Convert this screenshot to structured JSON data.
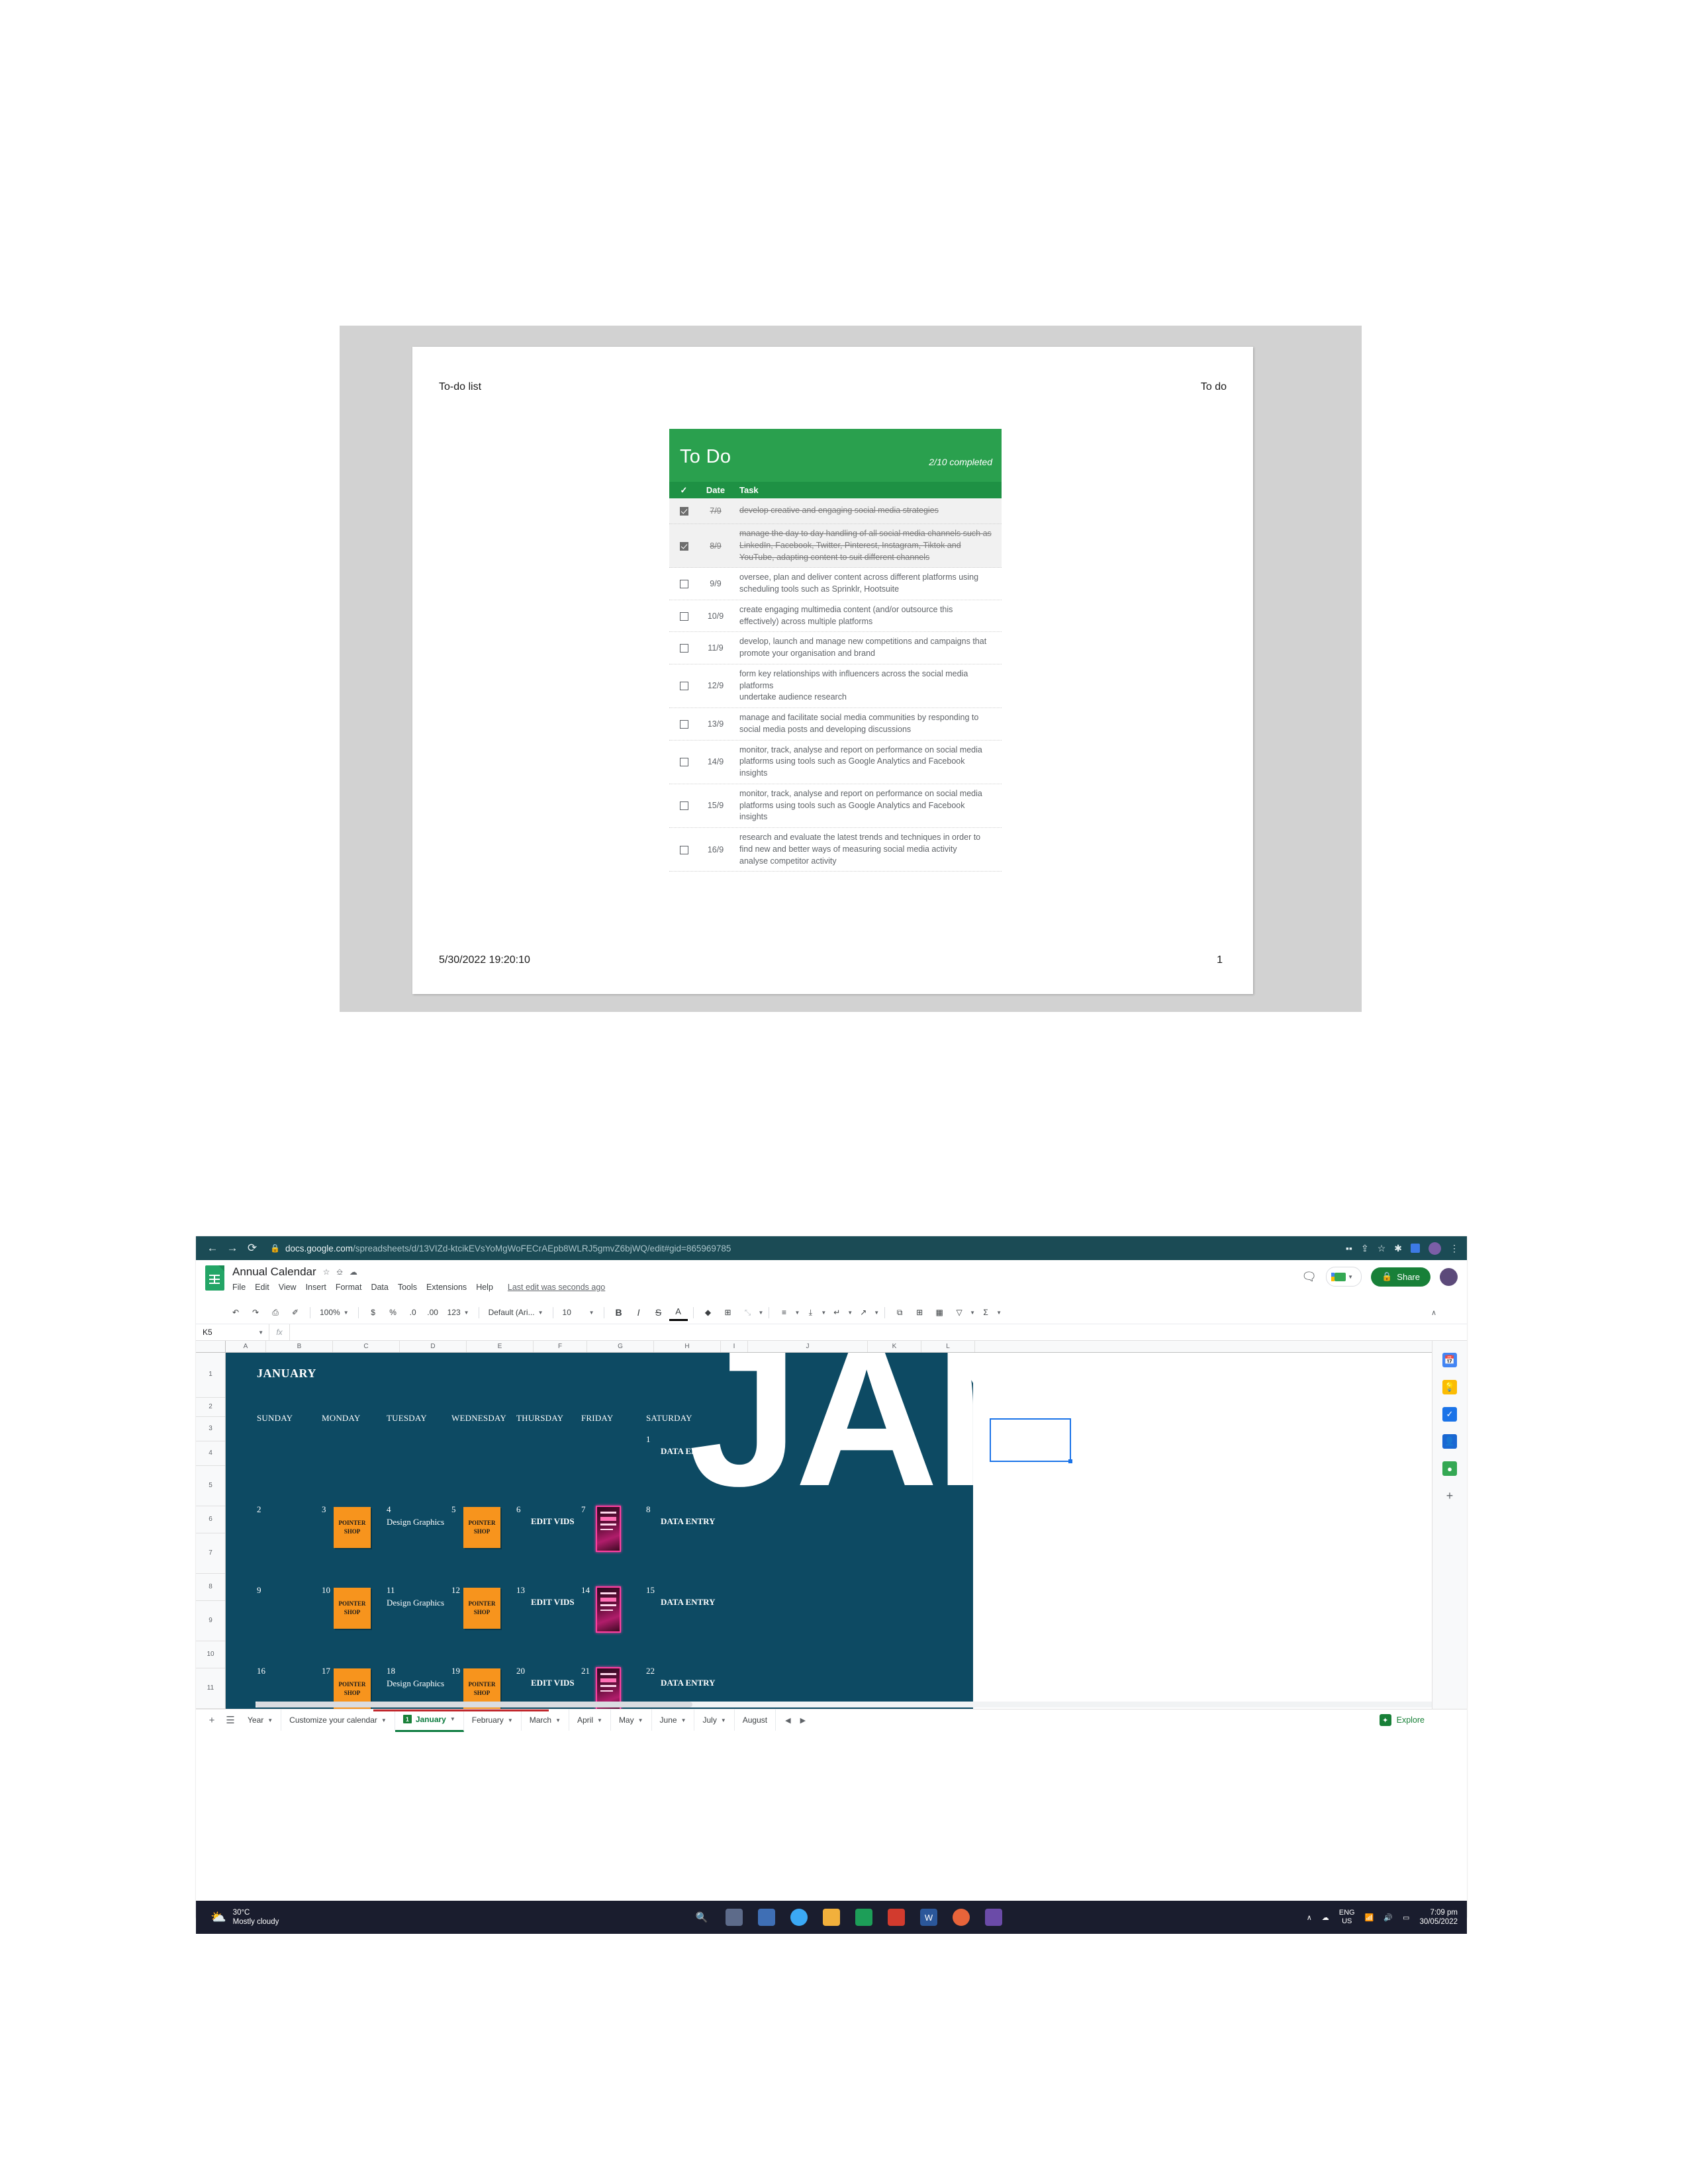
{
  "document_preview": {
    "header_left": "To-do list",
    "header_right": "To do",
    "footer_timestamp": "5/30/2022 19:20:10",
    "footer_page": "1",
    "card": {
      "title": "To Do",
      "progress": "2/10 completed",
      "columns": {
        "check": "✓",
        "date": "Date",
        "task": "Task"
      },
      "accent_header": "#2aa04e",
      "accent_columns": "#1e9144",
      "rows": [
        {
          "checked": true,
          "date": "7/9",
          "task": "develop creative and engaging social media strategies"
        },
        {
          "checked": true,
          "date": "8/9",
          "task": "manage the day to day handling of all social media channels such as LinkedIn, Facebook, Twitter, Pinterest, Instagram, Tiktok and YouTube, adapting content to suit different channels"
        },
        {
          "checked": false,
          "date": "9/9",
          "task": "oversee, plan and deliver content across different platforms using scheduling tools such as Sprinklr, Hootsuite"
        },
        {
          "checked": false,
          "date": "10/9",
          "task": "create engaging multimedia content (and/or outsource this effectively) across multiple platforms"
        },
        {
          "checked": false,
          "date": "11/9",
          "task": "develop, launch and manage new competitions and campaigns that promote your organisation and brand"
        },
        {
          "checked": false,
          "date": "12/9",
          "task": "form key relationships with influencers across the social media platforms\nundertake audience research"
        },
        {
          "checked": false,
          "date": "13/9",
          "task": "manage and facilitate social media communities by responding to social media posts and developing discussions"
        },
        {
          "checked": false,
          "date": "14/9",
          "task": "monitor, track, analyse and report on performance on social media platforms using tools such as Google Analytics and Facebook insights"
        },
        {
          "checked": false,
          "date": "15/9",
          "task": "monitor, track, analyse and report on performance on social media platforms using tools such as Google Analytics and Facebook insights"
        },
        {
          "checked": false,
          "date": "16/9",
          "task": "research and evaluate the latest trends and techniques in order to find new and better ways of measuring social media activity\nanalyse competitor activity"
        }
      ]
    }
  },
  "browser": {
    "back_icon": "←",
    "forward_icon": "→",
    "reload_icon": "⟳",
    "lock_icon": "🔒",
    "url_domain": "docs.google.com",
    "url_path": "/spreadsheets/d/13VIZd-ktcikEVsYoMgWoFECrAEpb8WLRJ5gmvZ6bjWQ/edit#gid=865969785",
    "chrome_bar_color": "#1b4b55"
  },
  "sheets": {
    "doc_title": "Annual Calendar",
    "title_icons": [
      "star-icon",
      "move-to-folder-icon",
      "cloud-status-icon"
    ],
    "menus": [
      "File",
      "Edit",
      "View",
      "Insert",
      "Format",
      "Data",
      "Tools",
      "Extensions",
      "Help"
    ],
    "last_edit": "Last edit was seconds ago",
    "share_label": "Share",
    "share_lock": "🔒",
    "toolbar": {
      "undo": "↶",
      "redo": "↷",
      "print": "⎙",
      "paint": "✐",
      "zoom": "100%",
      "currency": "$",
      "percent": "%",
      "dec_decrease": ".0",
      "dec_increase": ".00",
      "more_formats": "123",
      "font": "Default (Ari...",
      "font_size": "10",
      "bold": "B",
      "italic": "I",
      "strike": "S",
      "text_color": "A",
      "fill_color": "◆",
      "borders": "⊞",
      "merge": "⤡",
      "h_align": "≡",
      "v_align": "⤓",
      "wrap": "↵",
      "rotate": "↗",
      "link": "⧉",
      "comment": "⊞",
      "chart": "Ὄa",
      "filter": "▽",
      "functions": "Σ",
      "collapse": "∧"
    },
    "name_box": "K5",
    "fx_label": "fx",
    "formula_value": "",
    "columns": [
      "A",
      "B",
      "C",
      "D",
      "E",
      "F",
      "G",
      "H",
      "I",
      "J",
      "K",
      "L"
    ],
    "rows": [
      "1",
      "2",
      "3",
      "4",
      "5",
      "6",
      "7",
      "8",
      "9",
      "10",
      "11"
    ],
    "calendar": {
      "month": "JANUARY",
      "watermark": "JAN",
      "background": "#0d4a63",
      "daynames": [
        "SUNDAY",
        "MONDAY",
        "TUESDAY",
        "WEDNESDAY",
        "THURSDAY",
        "FRIDAY",
        "SATURDAY"
      ],
      "weeks": [
        [
          {
            "num": "",
            "label": "",
            "thumb": ""
          },
          {
            "num": "",
            "label": "",
            "thumb": ""
          },
          {
            "num": "",
            "label": "",
            "thumb": ""
          },
          {
            "num": "",
            "label": "",
            "thumb": ""
          },
          {
            "num": "",
            "label": "",
            "thumb": ""
          },
          {
            "num": "",
            "label": "",
            "thumb": ""
          },
          {
            "num": "1",
            "label": "DATA ENTRY",
            "thumb": ""
          }
        ],
        [
          {
            "num": "2",
            "label": "",
            "thumb": ""
          },
          {
            "num": "3",
            "label": "",
            "thumb": "pointer-shop"
          },
          {
            "num": "4",
            "label": "Design Graphics",
            "thumb": "",
            "plain": true
          },
          {
            "num": "5",
            "label": "",
            "thumb": "pointer-shop"
          },
          {
            "num": "6",
            "label": "EDIT VIDS",
            "thumb": ""
          },
          {
            "num": "7",
            "label": "",
            "thumb": "neon-poster"
          },
          {
            "num": "8",
            "label": "DATA ENTRY",
            "thumb": ""
          }
        ],
        [
          {
            "num": "9",
            "label": "",
            "thumb": ""
          },
          {
            "num": "10",
            "label": "",
            "thumb": "pointer-shop"
          },
          {
            "num": "11",
            "label": "Design Graphics",
            "thumb": "",
            "plain": true
          },
          {
            "num": "12",
            "label": "",
            "thumb": "pointer-shop"
          },
          {
            "num": "13",
            "label": "EDIT VIDS",
            "thumb": ""
          },
          {
            "num": "14",
            "label": "",
            "thumb": "neon-poster"
          },
          {
            "num": "15",
            "label": "DATA ENTRY",
            "thumb": ""
          }
        ],
        [
          {
            "num": "16",
            "label": "",
            "thumb": ""
          },
          {
            "num": "17",
            "label": "",
            "thumb": "pointer-shop"
          },
          {
            "num": "18",
            "label": "Design Graphics",
            "thumb": "",
            "plain": true
          },
          {
            "num": "19",
            "label": "",
            "thumb": "pointer-shop"
          },
          {
            "num": "20",
            "label": "EDIT VIDS",
            "thumb": ""
          },
          {
            "num": "21",
            "label": "",
            "thumb": "neon-poster"
          },
          {
            "num": "22",
            "label": "DATA ENTRY",
            "thumb": ""
          }
        ]
      ],
      "thumb_orange_line1": "POINTER",
      "thumb_orange_line2": "SHOP"
    },
    "sheet_tabs": {
      "add_label": "+",
      "all_sheets_label": "☰",
      "tabs": [
        {
          "label": "Year",
          "active": false,
          "badge": ""
        },
        {
          "label": "Customize your calendar",
          "active": false,
          "badge": ""
        },
        {
          "label": "January",
          "active": true,
          "badge": "1"
        },
        {
          "label": "February",
          "active": false,
          "badge": ""
        },
        {
          "label": "March",
          "active": false,
          "badge": ""
        },
        {
          "label": "April",
          "active": false,
          "badge": ""
        },
        {
          "label": "May",
          "active": false,
          "badge": ""
        },
        {
          "label": "June",
          "active": false,
          "badge": ""
        },
        {
          "label": "July",
          "active": false,
          "badge": ""
        },
        {
          "label": "August",
          "active": false,
          "badge": ""
        }
      ],
      "nav_prev": "◀",
      "nav_next": "▶",
      "explore_label": "Explore"
    },
    "sidebar_icons": [
      "calendar-icon",
      "keep-icon",
      "tasks-icon",
      "contacts-icon",
      "maps-icon",
      "add-on-icon"
    ]
  },
  "taskbar": {
    "weather_temp": "30°C",
    "weather_desc": "Mostly cloudy",
    "weather_icon": "⛅",
    "apps": [
      "start-icon",
      "search-icon",
      "task-view-icon",
      "widgets-icon",
      "chrome-icon",
      "file-explorer-icon",
      "sheets-icon",
      "mail-icon",
      "word-icon",
      "browser-icon",
      "media-icon"
    ],
    "tray_chevron": "∧",
    "tray_cloud": "☁",
    "tray_lang_line1": "ENG",
    "tray_lang_line2": "US",
    "tray_wifi": "◠",
    "tray_volume": "🔊",
    "tray_battery": "▭",
    "clock_time": "7:09 pm",
    "clock_date": "30/05/2022"
  }
}
